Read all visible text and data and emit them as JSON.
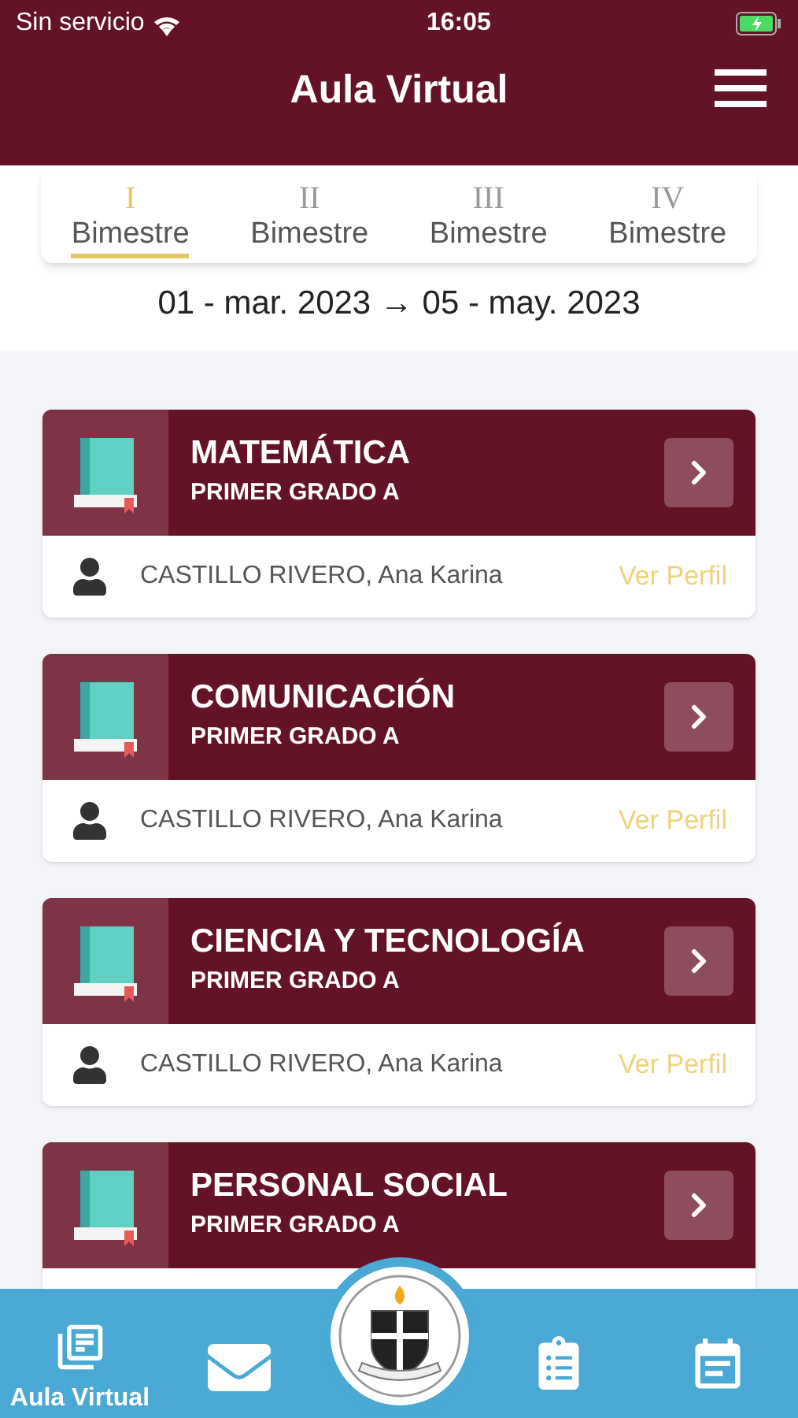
{
  "status_bar": {
    "carrier": "Sin servicio",
    "time": "16:05"
  },
  "header": {
    "title": "Aula Virtual"
  },
  "tabs": [
    {
      "numeral": "I",
      "label": "Bimestre",
      "selected": true
    },
    {
      "numeral": "II",
      "label": "Bimestre",
      "selected": false
    },
    {
      "numeral": "III",
      "label": "Bimestre",
      "selected": false
    },
    {
      "numeral": "IV",
      "label": "Bimestre",
      "selected": false
    }
  ],
  "date_range": "01 - mar. 2023 → 05 - may. 2023",
  "courses": [
    {
      "name": "MATEMÁTICA",
      "grade": "PRIMER GRADO A",
      "teacher": "CASTILLO RIVERO, Ana Karina",
      "profile_link": "Ver Perfil"
    },
    {
      "name": "COMUNICACIÓN",
      "grade": "PRIMER GRADO A",
      "teacher": "CASTILLO RIVERO, Ana Karina",
      "profile_link": "Ver Perfil"
    },
    {
      "name": "CIENCIA Y TECNOLOGÍA",
      "grade": "PRIMER GRADO A",
      "teacher": "CASTILLO RIVERO, Ana Karina",
      "profile_link": "Ver Perfil"
    },
    {
      "name": "PERSONAL SOCIAL",
      "grade": "PRIMER GRADO A"
    }
  ],
  "bottom_nav": [
    {
      "kind": "courses",
      "label": "Aula Virtual",
      "selected": true
    },
    {
      "kind": "messages",
      "selected": false
    },
    {
      "kind": "crest"
    },
    {
      "kind": "tasks",
      "selected": false
    },
    {
      "kind": "calendar",
      "selected": false
    }
  ]
}
